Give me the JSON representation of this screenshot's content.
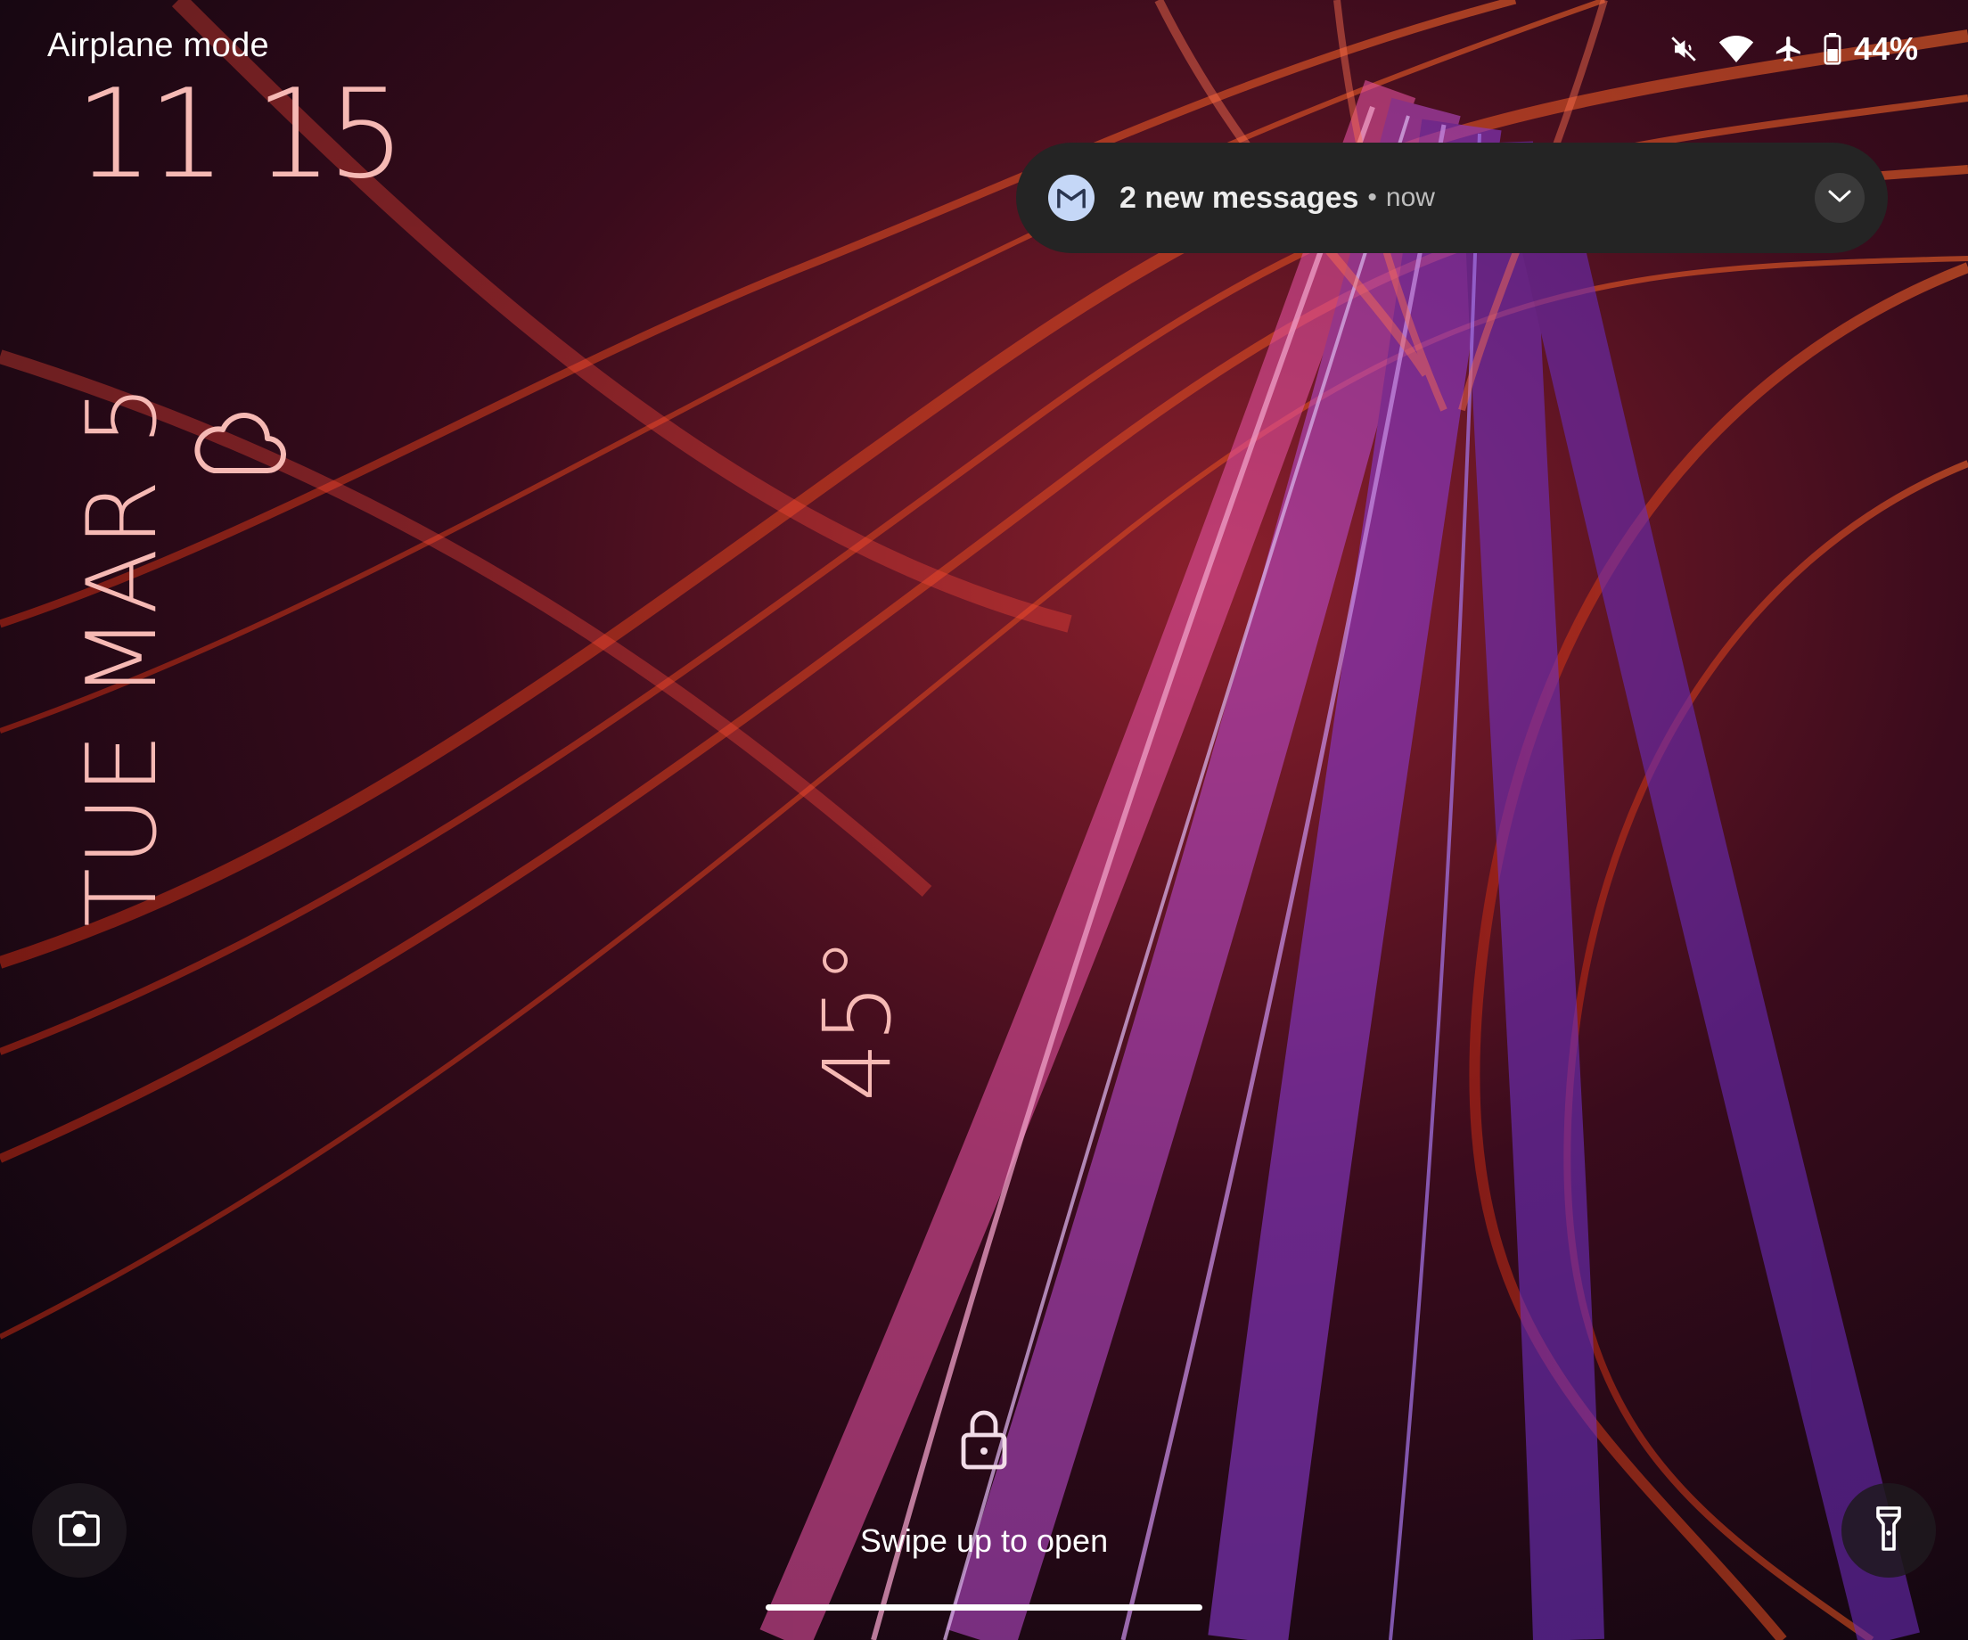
{
  "status_bar": {
    "network_label": "Airplane mode",
    "icons": [
      "mute-icon",
      "wifi-icon",
      "airplane-icon",
      "battery-icon"
    ],
    "battery_percent": "44%"
  },
  "clock": {
    "time": "11 15",
    "color": "#f6b9b4"
  },
  "date": {
    "text": "TUE MAR 5"
  },
  "weather": {
    "icon": "cloud-icon",
    "temperature": "45°"
  },
  "notification": {
    "app_icon": "gmail-icon",
    "title": "2 new messages",
    "separator": "•",
    "time": "now",
    "expand_icon": "chevron-down-icon"
  },
  "lock_screen": {
    "lock_icon": "lock-icon",
    "hint": "Swipe up to open"
  },
  "shortcuts": {
    "left": "camera-icon",
    "right": "flashlight-icon"
  },
  "theme": {
    "accent": "#f6b9b4",
    "notification_bg": "#242424"
  }
}
